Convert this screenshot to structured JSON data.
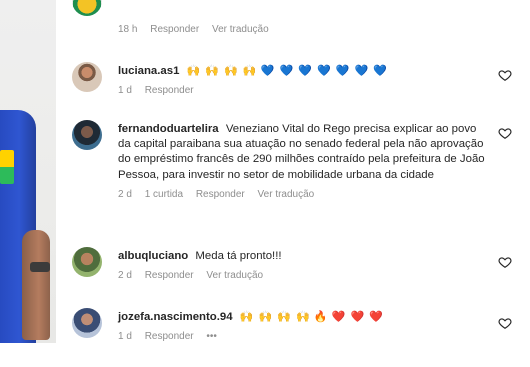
{
  "top_comment": {
    "time": "18 h",
    "reply_label": "Responder",
    "translate_label": "Ver tradução"
  },
  "comments": [
    {
      "username": "luciana.as1",
      "text": "",
      "emoji": "🙌 🙌 🙌 🙌",
      "emoji_hearts": "💙 💙 💙 💙 💙 💙 💙",
      "time": "1 d",
      "likes": "",
      "reply_label": "Responder",
      "translate_label": ""
    },
    {
      "username": "fernandoduartelira",
      "text": "Veneziano Vital do Rego precisa explicar ao povo da capital paraibana sua atuação no senado federal pela não aprovação do empréstimo francês de 290 milhões contraído pela prefeitura de João Pessoa, para investir no setor de mobilidade urbana da cidade",
      "time": "2 d",
      "likes": "1 curtida",
      "reply_label": "Responder",
      "translate_label": "Ver tradução"
    },
    {
      "username": "albuqluciano",
      "text": "Meda tá pronto!!!",
      "time": "2 d",
      "reply_label": "Responder",
      "translate_label": "Ver tradução"
    },
    {
      "username": "jozefa.nascimento.94",
      "emoji": "🙌 🙌 🙌 🙌",
      "emoji_extra": "🔥",
      "emoji_hearts": "❤️ ❤️ ❤️",
      "time": "1 d",
      "reply_label": "Responder",
      "more": "•••"
    }
  ],
  "colors": {
    "meta": "#8e8e8e",
    "text": "#262626",
    "heart_outline": "#262626"
  }
}
